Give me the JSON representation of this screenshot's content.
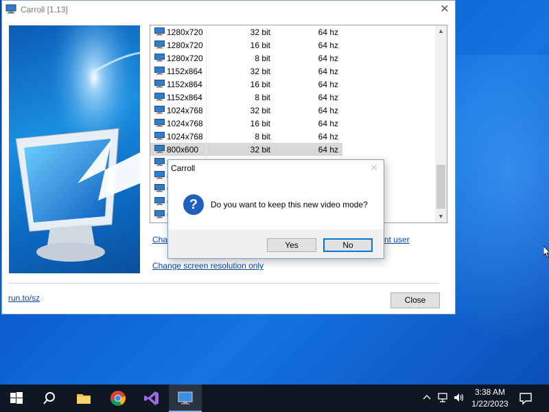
{
  "window": {
    "title": "Carroll [1.13]",
    "close_glyph": "✕"
  },
  "modes": [
    {
      "res": "1280x720",
      "bits": "32 bit",
      "hz": "64 hz",
      "selected": false
    },
    {
      "res": "1280x720",
      "bits": "16 bit",
      "hz": "64 hz",
      "selected": false
    },
    {
      "res": "1280x720",
      "bits": "8 bit",
      "hz": "64 hz",
      "selected": false
    },
    {
      "res": "1152x864",
      "bits": "32 bit",
      "hz": "64 hz",
      "selected": false
    },
    {
      "res": "1152x864",
      "bits": "16 bit",
      "hz": "64 hz",
      "selected": false
    },
    {
      "res": "1152x864",
      "bits": "8 bit",
      "hz": "64 hz",
      "selected": false
    },
    {
      "res": "1024x768",
      "bits": "32 bit",
      "hz": "64 hz",
      "selected": false
    },
    {
      "res": "1024x768",
      "bits": "16 bit",
      "hz": "64 hz",
      "selected": false
    },
    {
      "res": "1024x768",
      "bits": "8 bit",
      "hz": "64 hz",
      "selected": false
    },
    {
      "res": "800x600",
      "bits": "32 bit",
      "hz": "64 hz",
      "selected": true
    },
    {
      "res": "8",
      "bits": "",
      "hz": "",
      "selected": false
    },
    {
      "res": "8",
      "bits": "",
      "hz": "",
      "selected": false
    },
    {
      "res": "6",
      "bits": "",
      "hz": "",
      "selected": false
    },
    {
      "res": "6",
      "bits": "",
      "hz": "",
      "selected": false
    },
    {
      "res": "6",
      "bits": "",
      "hz": "",
      "selected": false
    }
  ],
  "links": {
    "change_current_left": "Cha",
    "change_current_right": "nt user",
    "change_resolution_only": "Change screen resolution only",
    "website": "run.to/sz"
  },
  "buttons": {
    "close": "Close"
  },
  "dialog": {
    "title": "Carroll",
    "close_glyph": "✕",
    "message": "Do you want to keep this new video mode?",
    "icon_glyph": "?",
    "yes": "Yes",
    "no": "No"
  },
  "taskbar": {
    "time": "3:38 AM",
    "date": "1/22/2023",
    "apps": [
      "start-icon",
      "search-icon",
      "file-explorer-icon",
      "chrome-icon",
      "visual-studio-icon",
      "carroll-icon"
    ]
  },
  "colors": {
    "accent": "#0078d7",
    "link": "#0645ad",
    "selected_row": "#d9d9d9"
  }
}
